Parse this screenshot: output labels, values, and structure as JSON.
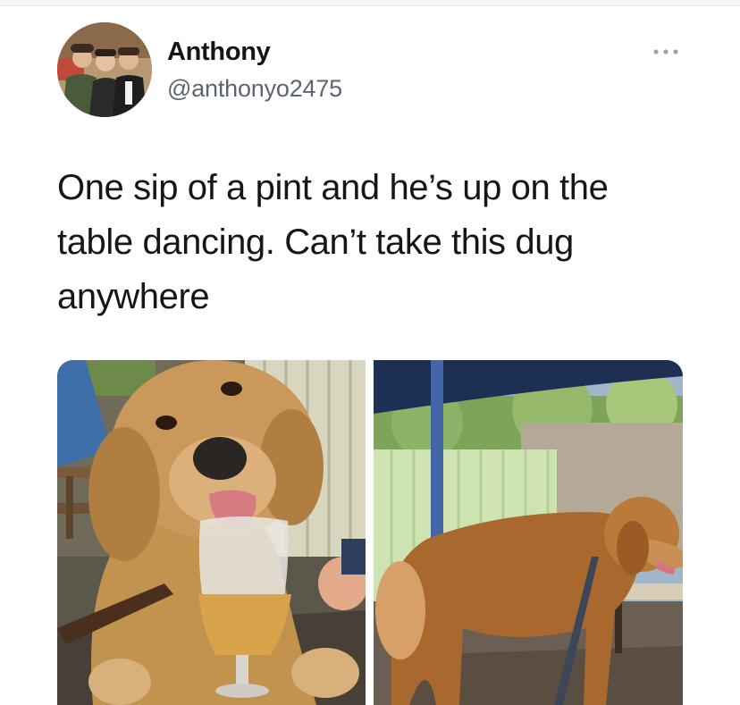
{
  "user": {
    "display_name": "Anthony",
    "handle": "@anthonyo2475"
  },
  "tweet": {
    "lines": [
      "One sip of a pint and he’s up on the",
      "table dancing. Can’t take this dug",
      "anywhere"
    ]
  },
  "media": {
    "count": 2
  },
  "icons": {
    "more": "more-horizontal-icon"
  },
  "colors": {
    "text": "#14171a",
    "secondary_text": "#5b6670"
  }
}
